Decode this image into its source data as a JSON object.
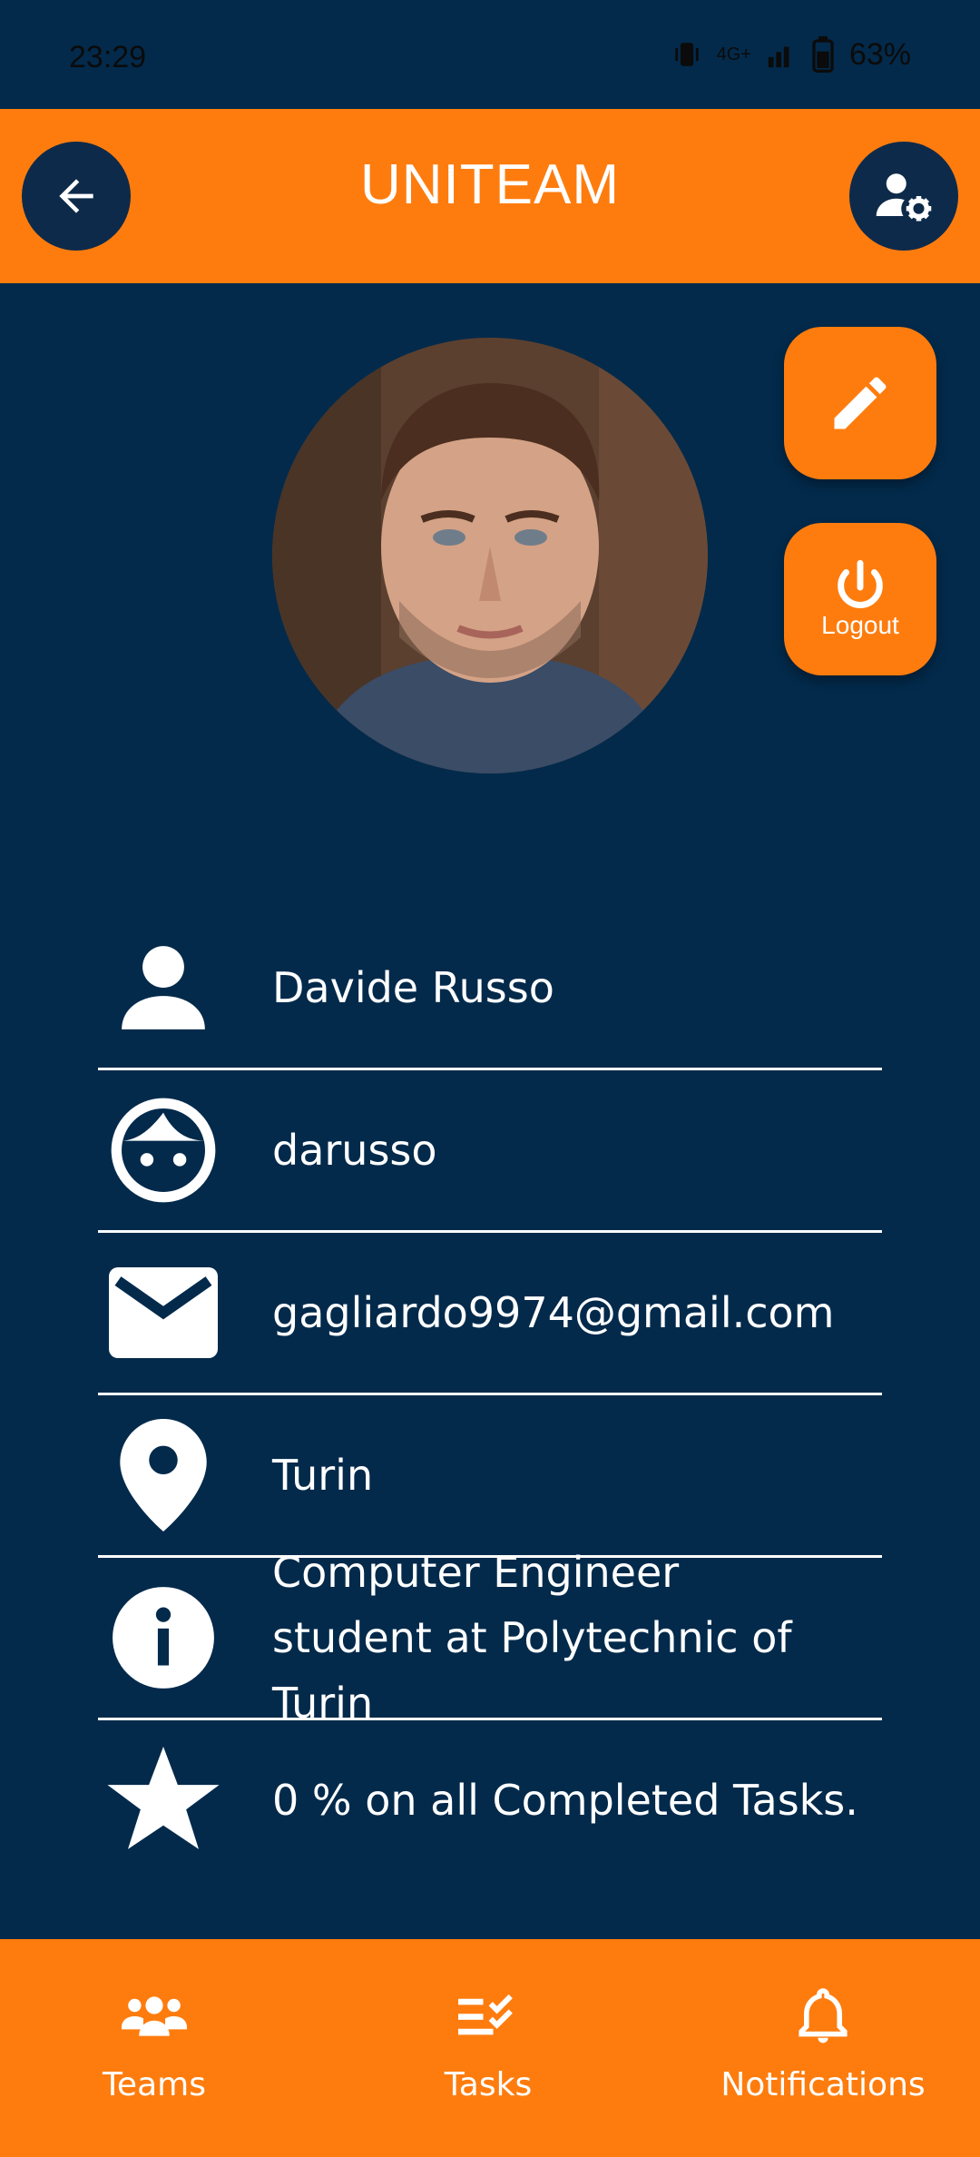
{
  "status_bar": {
    "time": "23:29",
    "network": "4G+",
    "battery": "63%"
  },
  "app_bar": {
    "title": "UNITEAM"
  },
  "actions": {
    "logout_label": "Logout"
  },
  "profile": {
    "full_name": "Davide Russo",
    "username": "darusso",
    "email": "gagliardo9974@gmail.com",
    "location": "Turin",
    "bio": "Computer Engineer student at Polytechnic of Turin",
    "completion": "0 % on all Completed Tasks."
  },
  "nav": {
    "teams": "Teams",
    "tasks": "Tasks",
    "notifications": "Notifications"
  },
  "colors": {
    "primary": "#fe7c0e",
    "background": "#032a4b",
    "dark_button": "#0e2a4a"
  },
  "icons": [
    "back-arrow-icon",
    "user-settings-icon",
    "edit-icon",
    "power-icon",
    "person-icon",
    "face-icon",
    "mail-icon",
    "location-pin-icon",
    "info-icon",
    "star-icon",
    "teams-icon",
    "tasks-icon",
    "bell-icon"
  ]
}
